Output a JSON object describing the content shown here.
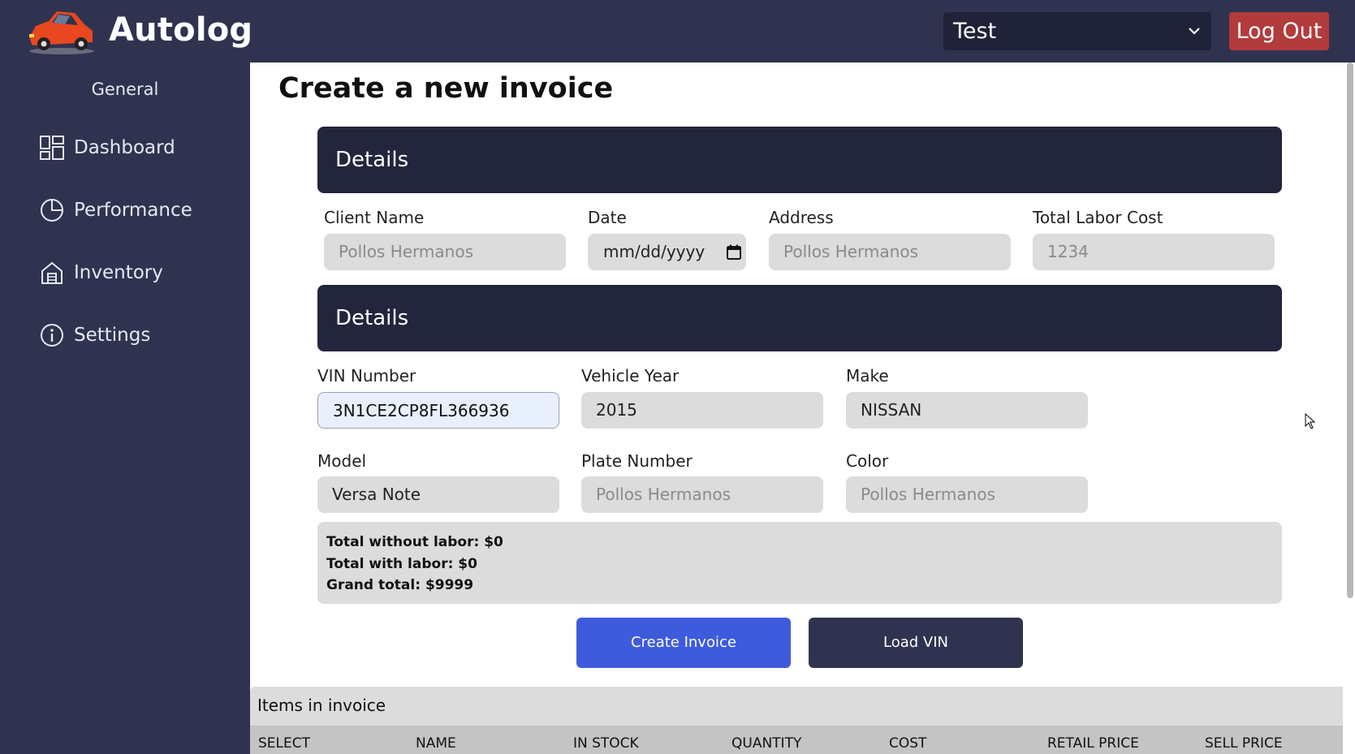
{
  "app": {
    "title": "Autolog",
    "logo": "red-car-logo"
  },
  "header": {
    "account_selected": "Test",
    "logout_label": "Log Out"
  },
  "sidebar": {
    "section": "General",
    "items": [
      {
        "label": "Dashboard",
        "icon": "dashboard-icon"
      },
      {
        "label": "Performance",
        "icon": "pie-chart-icon"
      },
      {
        "label": "Inventory",
        "icon": "house-icon"
      },
      {
        "label": "Settings",
        "icon": "info-icon"
      }
    ]
  },
  "main": {
    "title": "Create a new invoice",
    "details1": {
      "header": "Details",
      "client_name": {
        "label": "Client Name",
        "placeholder": "Pollos Hermanos"
      },
      "date": {
        "label": "Date",
        "placeholder": "mm/dd/yyyy"
      },
      "address": {
        "label": "Address",
        "placeholder": "Pollos Hermanos"
      },
      "labor_cost": {
        "label": "Total Labor Cost",
        "placeholder": "1234"
      }
    },
    "details2": {
      "header": "Details",
      "vin": {
        "label": "VIN Number",
        "value": "3N1CE2CP8FL366936"
      },
      "year": {
        "label": "Vehicle Year",
        "value": "2015"
      },
      "make": {
        "label": "Make",
        "value": "NISSAN"
      },
      "model": {
        "label": "Model",
        "value": "Versa Note"
      },
      "plate": {
        "label": "Plate Number",
        "placeholder": "Pollos Hermanos"
      },
      "color": {
        "label": "Color",
        "placeholder": "Pollos Hermanos"
      }
    },
    "totals": {
      "without_labor": "Total without labor: $0",
      "with_labor": "Total with labor: $0",
      "grand": "Grand total: $9999"
    },
    "buttons": {
      "create": "Create Invoice",
      "load": "Load VIN"
    },
    "items": {
      "title": "Items in invoice",
      "columns": [
        "SELECT",
        "NAME",
        "IN STOCK",
        "QUANTITY",
        "COST",
        "RETAIL PRICE",
        "SELL PRICE"
      ]
    }
  },
  "colors": {
    "topbar": "#2f3350",
    "section_header": "#23253d",
    "create_button": "#3e5bde",
    "logout_button": "#b23b3b"
  }
}
